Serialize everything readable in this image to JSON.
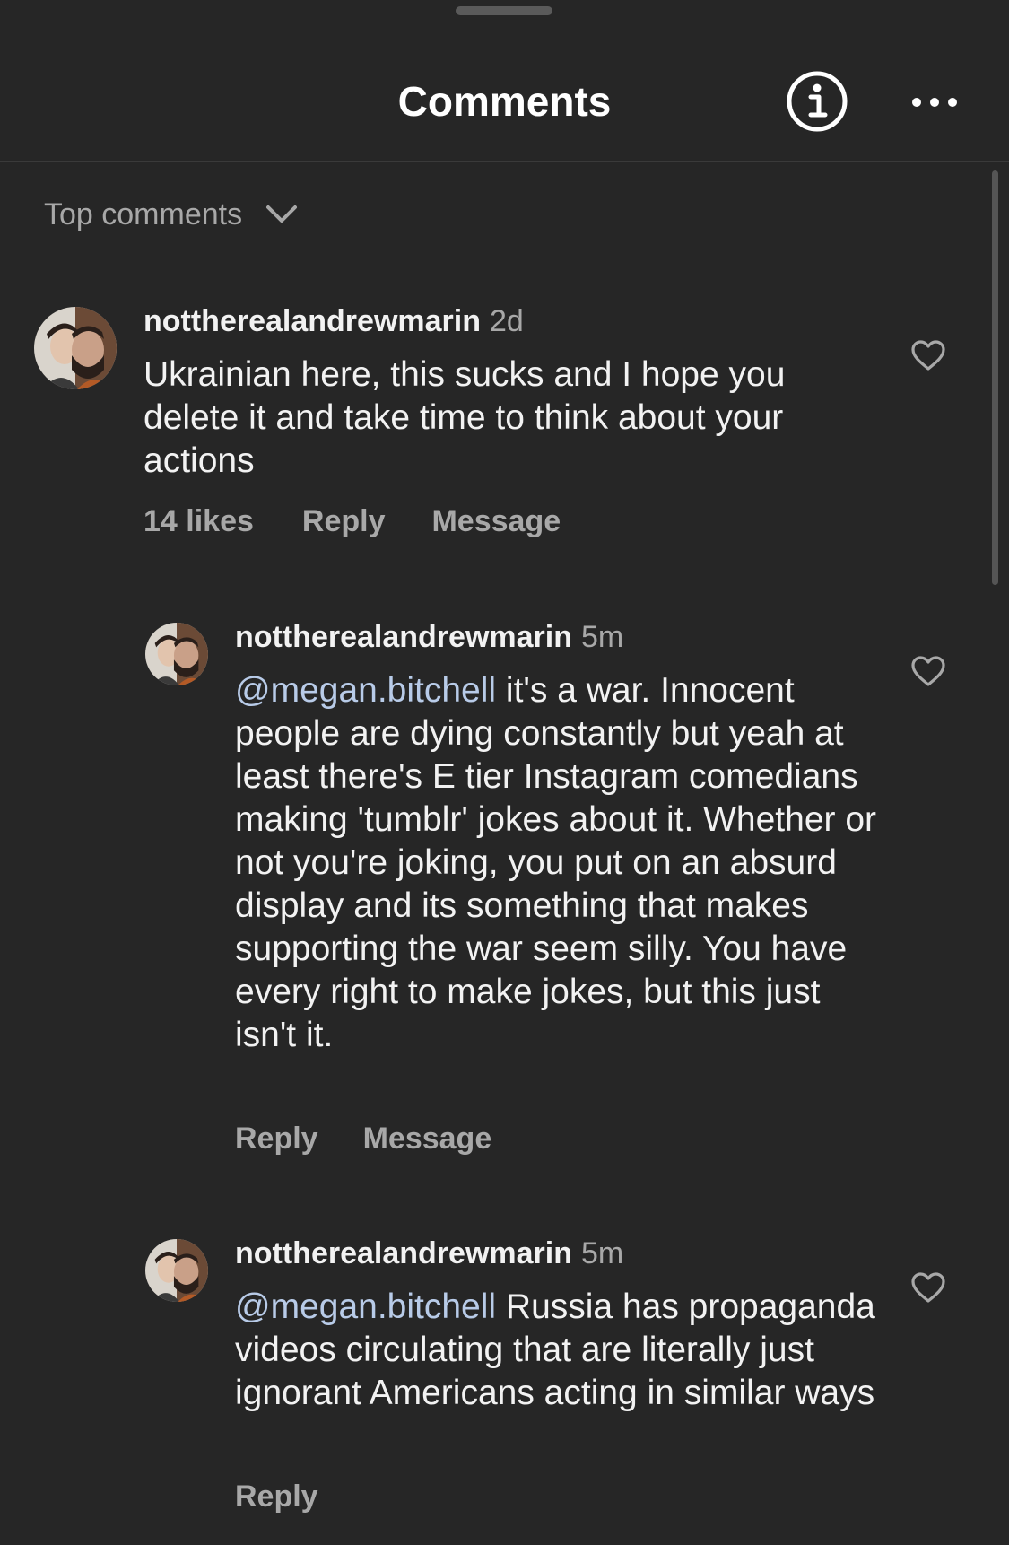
{
  "header": {
    "title": "Comments",
    "info_icon": "info-circle-icon",
    "more_icon": "more-horizontal-icon"
  },
  "sort": {
    "label": "Top comments",
    "icon": "chevron-down-icon"
  },
  "comments": [
    {
      "username": "nottherealandrewmarin",
      "time": "2d",
      "text": "Ukrainian here, this sucks and I hope you delete it and take time to think about your actions",
      "likes": "14 likes",
      "reply": "Reply",
      "message": "Message"
    },
    {
      "username": "nottherealandrewmarin",
      "time": "5m",
      "mention": "@megan.bitchell",
      "text": " it's a war. Innocent people are dying constantly but yeah at least there's E tier Instagram comedians making 'tumblr' jokes about it. Whether or not you're joking, you put on an absurd display and its something that makes supporting the war seem silly. You have every right to make jokes, but this just isn't it.",
      "reply": "Reply",
      "message": "Message"
    },
    {
      "username": "nottherealandrewmarin",
      "time": "5m",
      "mention": "@megan.bitchell",
      "text": " Russia has propaganda videos circulating that are literally just ignorant Americans acting in similar ways",
      "reply": "Reply"
    }
  ],
  "colors": {
    "background": "#262626",
    "text": "#f2f2f2",
    "secondary": "#a8a8a8",
    "mention": "#b8cbe8"
  }
}
